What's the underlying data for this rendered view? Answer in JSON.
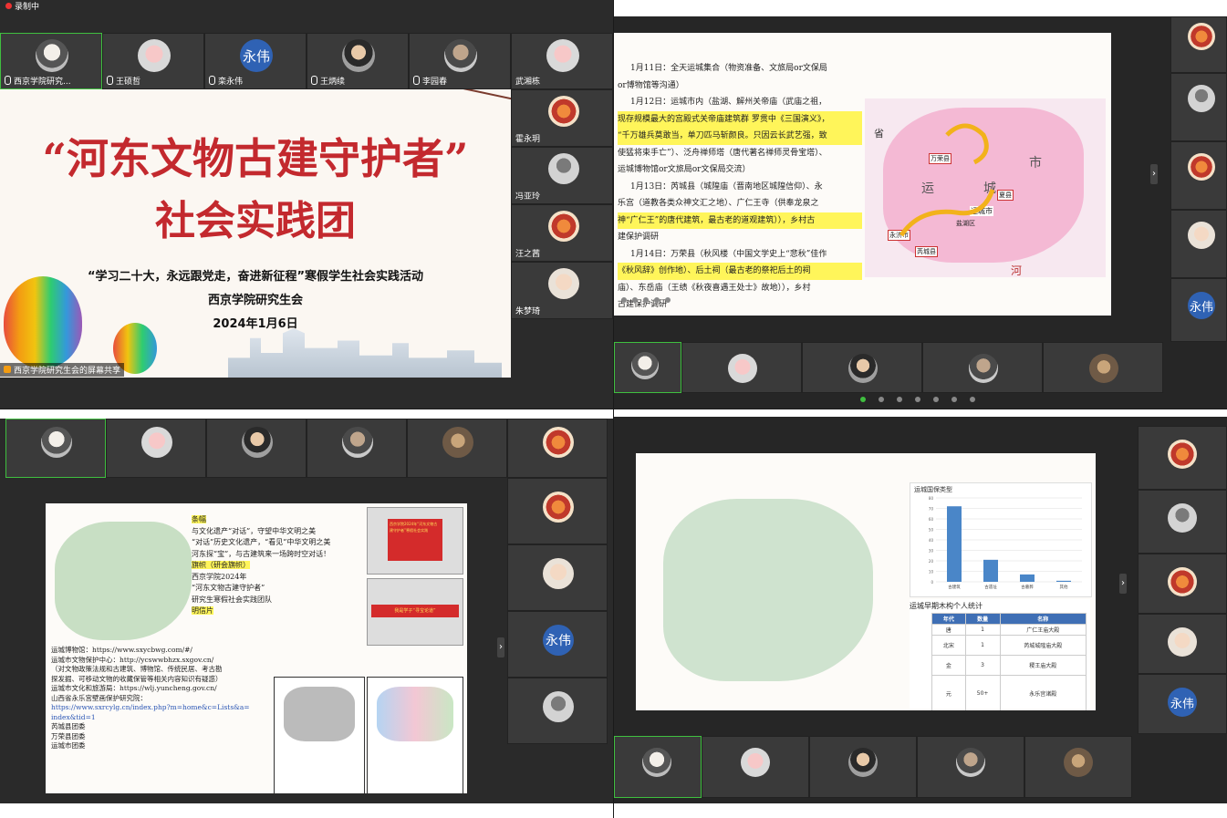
{
  "q1": {
    "recording": "录制中",
    "participants": [
      "西京学院研究...",
      "王硕哲",
      "栾永伟",
      "王炳续",
      "李园春",
      "武湘栋"
    ],
    "side_participants": [
      "霍永玥",
      "冯亚玲",
      "汪之茜",
      "朱梦琦"
    ],
    "avatar_text": "永伟",
    "share_label": "西京学院研究生会的屏幕共享",
    "slide": {
      "title_line1": "“河东文物古建守护者”",
      "title_line2": "社会实践团",
      "sub1": "“学习二十大，永远跟党走，奋进新征程”寒假学生社会实践活动",
      "sub2": "西京学院研究生会",
      "sub3": "2024年1月6日"
    }
  },
  "q2": {
    "lines": [
      "1月11日：全天运城集合（物资准备、文旅局or文保局",
      "or博物馆等沟通）",
      "1月12日：运城市内（盐湖、解州关帝庙（武庙之祖，",
      "现存规模最大的宫殿式关帝庙建筑群 罗贯中《三国演义》，",
      "“千万雄兵莫敢当，单刀匹马斩颜良。只因云长武艺强，致",
      "使猛将束手亡”）、泛舟禅师塔（唐代著名禅师灵骨宝塔）、",
      "运城博物馆or文旅局or文保局交流）",
      "1月13日：芮城县（城隍庙（晋南地区城隍信仰）、永",
      "乐宫（道教各类众神文汇之地）、广仁王寺（供奉龙泉之",
      "神“广仁王”的唐代建筑，最古老的道观建筑）），乡村古",
      "建保护调研",
      "1月14日：万荣县（秋风楼（中国文学史上“悲秋”佳作",
      "《秋风辞》创作地）、后土祠（最古老的祭祀后土的祠",
      "庙）、东岳庙（王绩《秋夜喜遇王处士》故地）），乡村",
      "古建保护调研"
    ],
    "map_labels": [
      "省",
      "运",
      "城",
      "市",
      "芮城县",
      "永济市",
      "万荣县",
      "盐湖区",
      "夏县",
      "运城市",
      "河"
    ],
    "side_avatar_text": "永伟"
  },
  "q3": {
    "slide_heading": "条幅",
    "text": [
      "与文化遗产“对话”，守望中华文明之美",
      "“对话”历史文化遗产，“看见”中华文明之美",
      "河东探“宝”，与古建筑来一场跨时空对话！",
      "旗帜（研会旗帜）",
      "西京学院2024年",
      "“河东文物古建守护者”",
      "研究生寒假社会实践团队",
      "明信片"
    ],
    "links": [
      "运城博物馆：https://www.sxycbwg.com/#/",
      "运城市文物保护中心：http://ycswwbhzx.sxgov.cn/",
      "（对文物政策法规和古建筑、博物馆、传统民居、考古勘",
      "探发掘、可移动文物的收藏保管等相关内容知识有疑惑）",
      "运城市文化和旅游局：https://wlj.yuncheng.gov.cn/",
      "山西省永乐宫壁画保护研究院：",
      "https://www.sxrcylg.cn/index.php?m=home&c=Lists&a=",
      "index&tid=1",
      "芮城县团委",
      "万荣县团委",
      "运城市团委"
    ],
    "banner1": "西京学院2024年“河东文物古建守护者”寒假社会实践",
    "banner2": "我是学子“寻宝论道”",
    "avatar_text": "永伟"
  },
  "q4": {
    "chart_data": {
      "type": "bar",
      "title": "运城国保类型",
      "categories": [
        "古建筑",
        "古遗址",
        "古墓葬",
        "其他"
      ],
      "values": [
        72,
        21,
        7,
        1
      ],
      "ylim": [
        0,
        80
      ],
      "yticks": [
        0,
        10,
        20,
        30,
        40,
        50,
        60,
        70,
        80
      ]
    },
    "table_title": "运城早期木构个人统计",
    "table_headers": [
      "年代",
      "数量",
      "名称"
    ],
    "table_rows": [
      [
        "唐",
        "1",
        "广仁王庙大殿"
      ],
      [
        "北宋",
        "1",
        "芮城城隍庙大殿"
      ],
      [
        "金",
        "3",
        "稷王庙大殿"
      ],
      [
        "元",
        "50+",
        "永乐宫诸殿"
      ]
    ],
    "avatar_text": "永伟"
  }
}
